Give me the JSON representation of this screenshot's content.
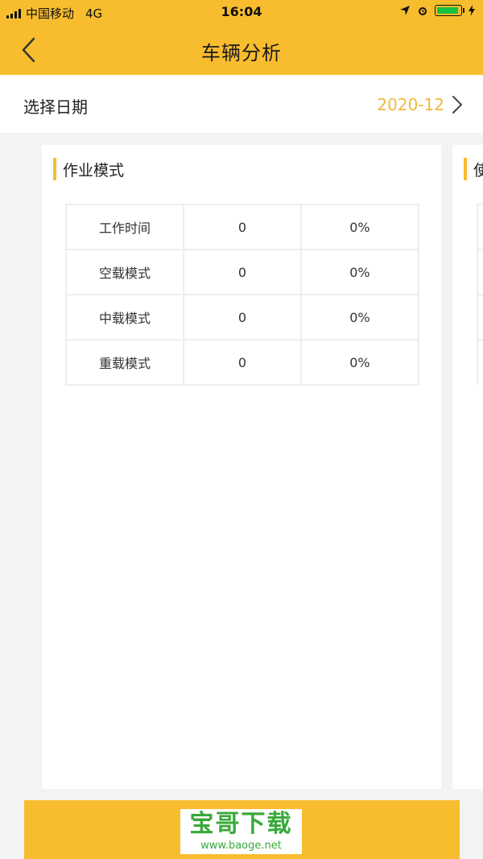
{
  "status_bar": {
    "carrier": "中国移动",
    "network": "4G",
    "time": "16:04"
  },
  "nav": {
    "title": "车辆分析",
    "back_icon": "chevron-left-icon"
  },
  "date_row": {
    "label": "选择日期",
    "value": "2020-12",
    "chevron_icon": "chevron-right-icon"
  },
  "card": {
    "title": "作业模式",
    "rows": [
      [
        "工作时间",
        "0",
        "0%"
      ],
      [
        "空载模式",
        "0",
        "0%"
      ],
      [
        "中载模式",
        "0",
        "0%"
      ],
      [
        "重载模式",
        "0",
        "0%"
      ]
    ]
  },
  "peek_card": {
    "title": "使"
  },
  "watermark": {
    "title": "宝哥下载",
    "url": "www.baoge.net"
  },
  "colors": {
    "accent": "#f8bd2e",
    "date_value": "#f1b93a",
    "watermark_green": "#39a93a"
  }
}
